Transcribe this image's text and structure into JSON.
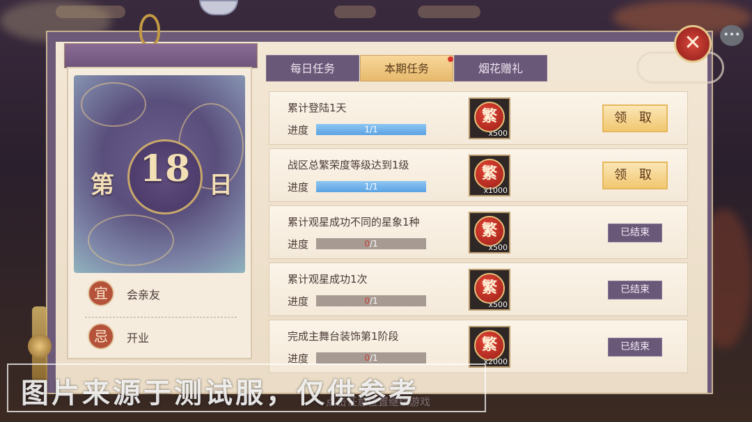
{
  "tabs": [
    {
      "label": "每日任务",
      "active": false
    },
    {
      "label": "本期任务",
      "active": true,
      "has_dot": true
    },
    {
      "label": "烟花赠礼",
      "active": false
    }
  ],
  "calendar": {
    "day_prefix": "第",
    "day_number": "18",
    "day_suffix": "日",
    "good_seal": "宜",
    "good_text": "会亲友",
    "bad_seal": "忌",
    "bad_text": "开业"
  },
  "progress_label": "进度",
  "tasks": [
    {
      "title": "累计登陆1天",
      "progress_current": "1",
      "progress_total": "1",
      "progress_fraction": 1.0,
      "reward_glyph": "繁",
      "reward_qty": "x500",
      "action": "领 取",
      "state": "claim"
    },
    {
      "title": "战区总繁荣度等级达到1级",
      "progress_current": "1",
      "progress_total": "1",
      "progress_fraction": 1.0,
      "reward_glyph": "繁",
      "reward_qty": "x1000",
      "action": "领 取",
      "state": "claim"
    },
    {
      "title": "累计观星成功不同的星象1种",
      "progress_current": "0",
      "progress_total": "1",
      "progress_fraction": 0.0,
      "reward_glyph": "繁",
      "reward_qty": "x500",
      "action": "已结束",
      "state": "ended"
    },
    {
      "title": "累计观星成功1次",
      "progress_current": "0",
      "progress_total": "1",
      "progress_fraction": 0.0,
      "reward_glyph": "繁",
      "reward_qty": "x500",
      "action": "已结束",
      "state": "ended"
    },
    {
      "title": "完成主舞台装饰第1阶段",
      "progress_current": "0",
      "progress_total": "1",
      "progress_fraction": 0.0,
      "reward_glyph": "繁",
      "reward_qty": "x2000",
      "action": "已结束",
      "state": "ended"
    }
  ],
  "close_symbol": "✕",
  "chat_symbol": "•••",
  "hint": "点击任意位置继续游戏",
  "watermark": "图片来源于测试服，仅供参考",
  "colors": {
    "tab_active": "#e7b96c",
    "tab_inactive": "#6a5878",
    "progress_fill": "#5aa2e3",
    "progress_zero": "#c14235",
    "claim_button": "#f1c770",
    "ended_button": "#6a5878"
  }
}
